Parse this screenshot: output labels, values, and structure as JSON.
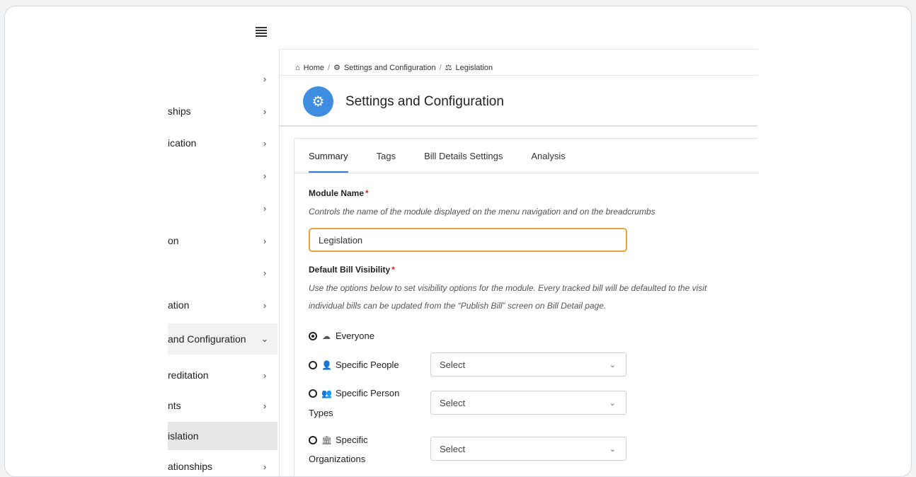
{
  "sidebar": {
    "items": [
      {
        "label": "",
        "chevron": "›"
      },
      {
        "label": "ships",
        "chevron": "›"
      },
      {
        "label": "ication",
        "chevron": "›"
      },
      {
        "label": "",
        "chevron": "›"
      },
      {
        "label": "",
        "chevron": "›"
      },
      {
        "label": "on",
        "chevron": "›"
      },
      {
        "label": "",
        "chevron": "›"
      },
      {
        "label": "ation",
        "chevron": "›"
      },
      {
        "label": "and Configuration",
        "chevron": "⌄"
      },
      {
        "label": "reditation",
        "chevron": "›"
      },
      {
        "label": "nts",
        "chevron": "›"
      },
      {
        "label": "islation",
        "chevron": ""
      },
      {
        "label": "ationships",
        "chevron": "›"
      }
    ]
  },
  "breadcrumb": {
    "home": "Home",
    "sep": "/",
    "settings": "Settings and Configuration",
    "current": "Legislation",
    "home_icon": "⌂",
    "settings_icon": "⚙",
    "legislation_icon": "⚖"
  },
  "header": {
    "title": "Settings and Configuration",
    "icon": "⚙"
  },
  "tabs": [
    {
      "label": "Summary"
    },
    {
      "label": "Tags"
    },
    {
      "label": "Bill Details Settings"
    },
    {
      "label": "Analysis"
    }
  ],
  "module_name": {
    "label": "Module Name",
    "required": "*",
    "hint": "Controls the name of the module displayed on the menu navigation and on the breadcrumbs",
    "value": "Legislation"
  },
  "visibility": {
    "label": "Default Bill Visibility",
    "required": "*",
    "hint_line1": "Use the options below to set visibility options for the module. Every tracked bill will be defaulted to the visit",
    "hint_line2": "individual bills can be updated from the “Publish Bill” screen on Bill Detail page.",
    "options": [
      {
        "label": "Everyone",
        "icon": "☁"
      },
      {
        "label": "Specific People",
        "icon": "👤",
        "select": "Select"
      },
      {
        "label": "Specific Person",
        "label2": "Types",
        "icon": "👥",
        "select": "Select"
      },
      {
        "label": "Specific",
        "label2": "Organizations",
        "icon": "🏛",
        "select": "Select"
      }
    ]
  },
  "select_caret": "⌄"
}
